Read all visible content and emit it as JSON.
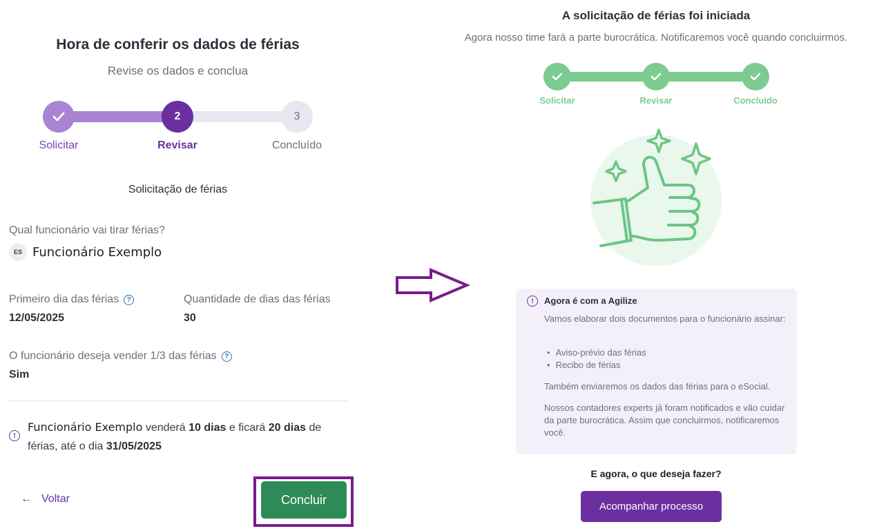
{
  "review": {
    "title": "Hora de conferir os dados de férias",
    "subtitle": "Revise os dados e conclua",
    "steps": [
      {
        "label": "Solicitar",
        "number": "1",
        "state": "done"
      },
      {
        "label": "Revisar",
        "number": "2",
        "state": "current"
      },
      {
        "label": "Concluído",
        "number": "3",
        "state": "pending"
      }
    ],
    "section_title": "Solicitação de férias",
    "employee_question": "Qual funcionário vai tirar férias?",
    "employee_initials": "ES",
    "employee_name": "Funcionário Exemplo",
    "first_day_label": "Primeiro dia das férias",
    "first_day_value": "12/05/2025",
    "days_count_label": "Quantidade de dias das férias",
    "days_count_value": "30",
    "sell_label": "O funcionário deseja vender 1/3 das férias",
    "sell_value": "Sim",
    "summary": {
      "employee": "Funcionário Exemplo",
      "part1": "venderá",
      "sold_days": "10 dias",
      "part2": "e ficará",
      "kept_days": "20 dias",
      "part3": "de férias, até o dia",
      "end_date": "31/05/2025"
    },
    "back_label": "Voltar",
    "conclude_label": "Concluir"
  },
  "done": {
    "title": "A solicitação de férias foi iniciada",
    "subtitle": "Agora nosso time fará a parte burocrática. Notificaremos você quando concluirmos.",
    "steps": [
      {
        "label": "Solicitar",
        "state": "done"
      },
      {
        "label": "Revisar",
        "state": "done"
      },
      {
        "label": "Concluído",
        "state": "done"
      }
    ],
    "info": {
      "title": "Agora é com a Agilize",
      "intro": "Vamos elaborar dois documentos para o funcionário assinar:",
      "documents": [
        "Aviso-prévio das férias",
        "Recibo de férias"
      ],
      "esocial": "Também enviaremos os dados das férias para o eSocial.",
      "closing": "Nossos contadores experts já foram notificados e vão cuidar da parte burocrática. Assim que concluirmos, notificaremos você."
    },
    "next_question": "E agora, o que deseja fazer?",
    "track_label": "Acompanhar processo"
  },
  "colors": {
    "purple": "#6b2fa0",
    "purple_light": "#a884d3",
    "green": "#2e8b57",
    "green_light": "#7ccb91",
    "highlight": "#7a1a8c"
  },
  "icons": [
    "check-icon",
    "help-circle-icon",
    "info-circle-icon",
    "arrow-left-icon",
    "thumbs-up-illustration",
    "sparkle-icon",
    "right-arrow-annotation"
  ]
}
